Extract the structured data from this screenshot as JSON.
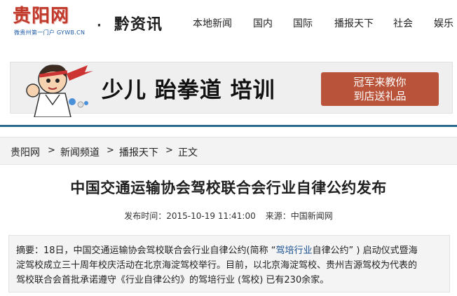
{
  "header": {
    "logo_text": "贵阳网",
    "logo_sub": "微贵州第一门户 GYWB.CN",
    "separator": "·",
    "channel": "黔资讯",
    "nav": [
      "本地新闻",
      "国内",
      "国际",
      "播报天下",
      "社会",
      "娱乐"
    ]
  },
  "banner": {
    "title": "少儿 跆拳道 培训",
    "promo_line1": "冠军来教你",
    "promo_line2": "到店送礼品"
  },
  "breadcrumb": {
    "items": [
      "贵阳网",
      "新闻频道",
      "播报天下",
      "正文"
    ],
    "separator": ">"
  },
  "article": {
    "title": "中国交通运输协会驾校联合会行业自律公约发布",
    "publish_label": "发布时间：",
    "publish_time": "2015-10-19 11:41:00",
    "source_label": "来源：",
    "source": "中国新闻网",
    "summary": {
      "line1_a": "摘要：18日，中国交通运输协会驾校联合会行业自律公约(简称 “",
      "line1_hl": "驾培行业",
      "line1_b": "自律公约” ) 启动仪式暨海",
      "line2": "淀驾校成立三十周年校庆活动在北京海淀驾校举行。目前，以北京海淀驾校、贵州吉源驾校为代表的",
      "line3": "驾校联合会首批承诺遵守《行业自律公约》的驾培行业 (驾校) 已有230余家。"
    }
  },
  "colors": {
    "logo_red": "#c0392b",
    "divider_blue": "#2a6a8f",
    "promo_bg": "#b9543a",
    "highlight_blue": "#1a4f8f"
  }
}
